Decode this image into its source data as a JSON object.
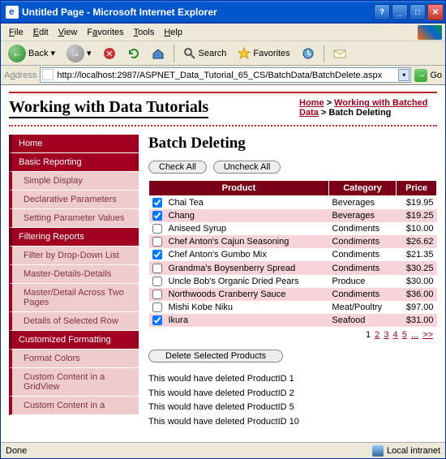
{
  "window": {
    "title": "Untitled Page - Microsoft Internet Explorer"
  },
  "menu": {
    "file": "File",
    "edit": "Edit",
    "view": "View",
    "favorites": "Favorites",
    "tools": "Tools",
    "help": "Help"
  },
  "toolbar": {
    "back": "Back",
    "search": "Search",
    "favorites": "Favorites"
  },
  "address": {
    "label": "Address",
    "url": "http://localhost:2987/ASPNET_Data_Tutorial_65_CS/BatchData/BatchDelete.aspx",
    "go": "Go"
  },
  "header": {
    "site_title": "Working with Data Tutorials",
    "breadcrumb": {
      "home": "Home",
      "group": "Working with Batched Data",
      "current": "Batch Deleting"
    }
  },
  "sidebar": [
    {
      "type": "cat",
      "label": "Home"
    },
    {
      "type": "cat",
      "label": "Basic Reporting"
    },
    {
      "type": "item",
      "label": "Simple Display"
    },
    {
      "type": "item",
      "label": "Declarative Parameters"
    },
    {
      "type": "item",
      "label": "Setting Parameter Values"
    },
    {
      "type": "cat",
      "label": "Filtering Reports"
    },
    {
      "type": "item",
      "label": "Filter by Drop-Down List"
    },
    {
      "type": "item",
      "label": "Master-Details-Details"
    },
    {
      "type": "item",
      "label": "Master/Detail Across Two Pages"
    },
    {
      "type": "item",
      "label": "Details of Selected Row"
    },
    {
      "type": "cat",
      "label": "Customized Formatting"
    },
    {
      "type": "item",
      "label": "Format Colors"
    },
    {
      "type": "item",
      "label": "Custom Content in a GridView"
    },
    {
      "type": "item",
      "label": "Custom Content in a"
    }
  ],
  "main": {
    "heading": "Batch Deleting",
    "check_all": "Check All",
    "uncheck_all": "Uncheck All",
    "columns": {
      "product": "Product",
      "category": "Category",
      "price": "Price"
    },
    "rows": [
      {
        "checked": true,
        "product": "Chai Tea",
        "category": "Beverages",
        "price": "$19.95"
      },
      {
        "checked": true,
        "product": "Chang",
        "category": "Beverages",
        "price": "$19.25"
      },
      {
        "checked": false,
        "product": "Aniseed Syrup",
        "category": "Condiments",
        "price": "$10.00"
      },
      {
        "checked": false,
        "product": "Chef Anton's Cajun Seasoning",
        "category": "Condiments",
        "price": "$26.62"
      },
      {
        "checked": true,
        "product": "Chef Anton's Gumbo Mix",
        "category": "Condiments",
        "price": "$21.35"
      },
      {
        "checked": false,
        "product": "Grandma's Boysenberry Spread",
        "category": "Condiments",
        "price": "$30.25"
      },
      {
        "checked": false,
        "product": "Uncle Bob's Organic Dried Pears",
        "category": "Produce",
        "price": "$30.00"
      },
      {
        "checked": false,
        "product": "Northwoods Cranberry Sauce",
        "category": "Condiments",
        "price": "$36.00"
      },
      {
        "checked": false,
        "product": "Mishi Kobe Niku",
        "category": "Meat/Poultry",
        "price": "$97.00"
      },
      {
        "checked": true,
        "product": "Ikura",
        "category": "Seafood",
        "price": "$31.00"
      }
    ],
    "pager": {
      "current": "1",
      "links": [
        "2",
        "3",
        "4",
        "5",
        "...",
        ">>"
      ]
    },
    "delete_button": "Delete Selected Products",
    "results": [
      "This would have deleted ProductID 1",
      "This would have deleted ProductID 2",
      "This would have deleted ProductID 5",
      "This would have deleted ProductID 10"
    ]
  },
  "status": {
    "done": "Done",
    "zone": "Local intranet"
  }
}
